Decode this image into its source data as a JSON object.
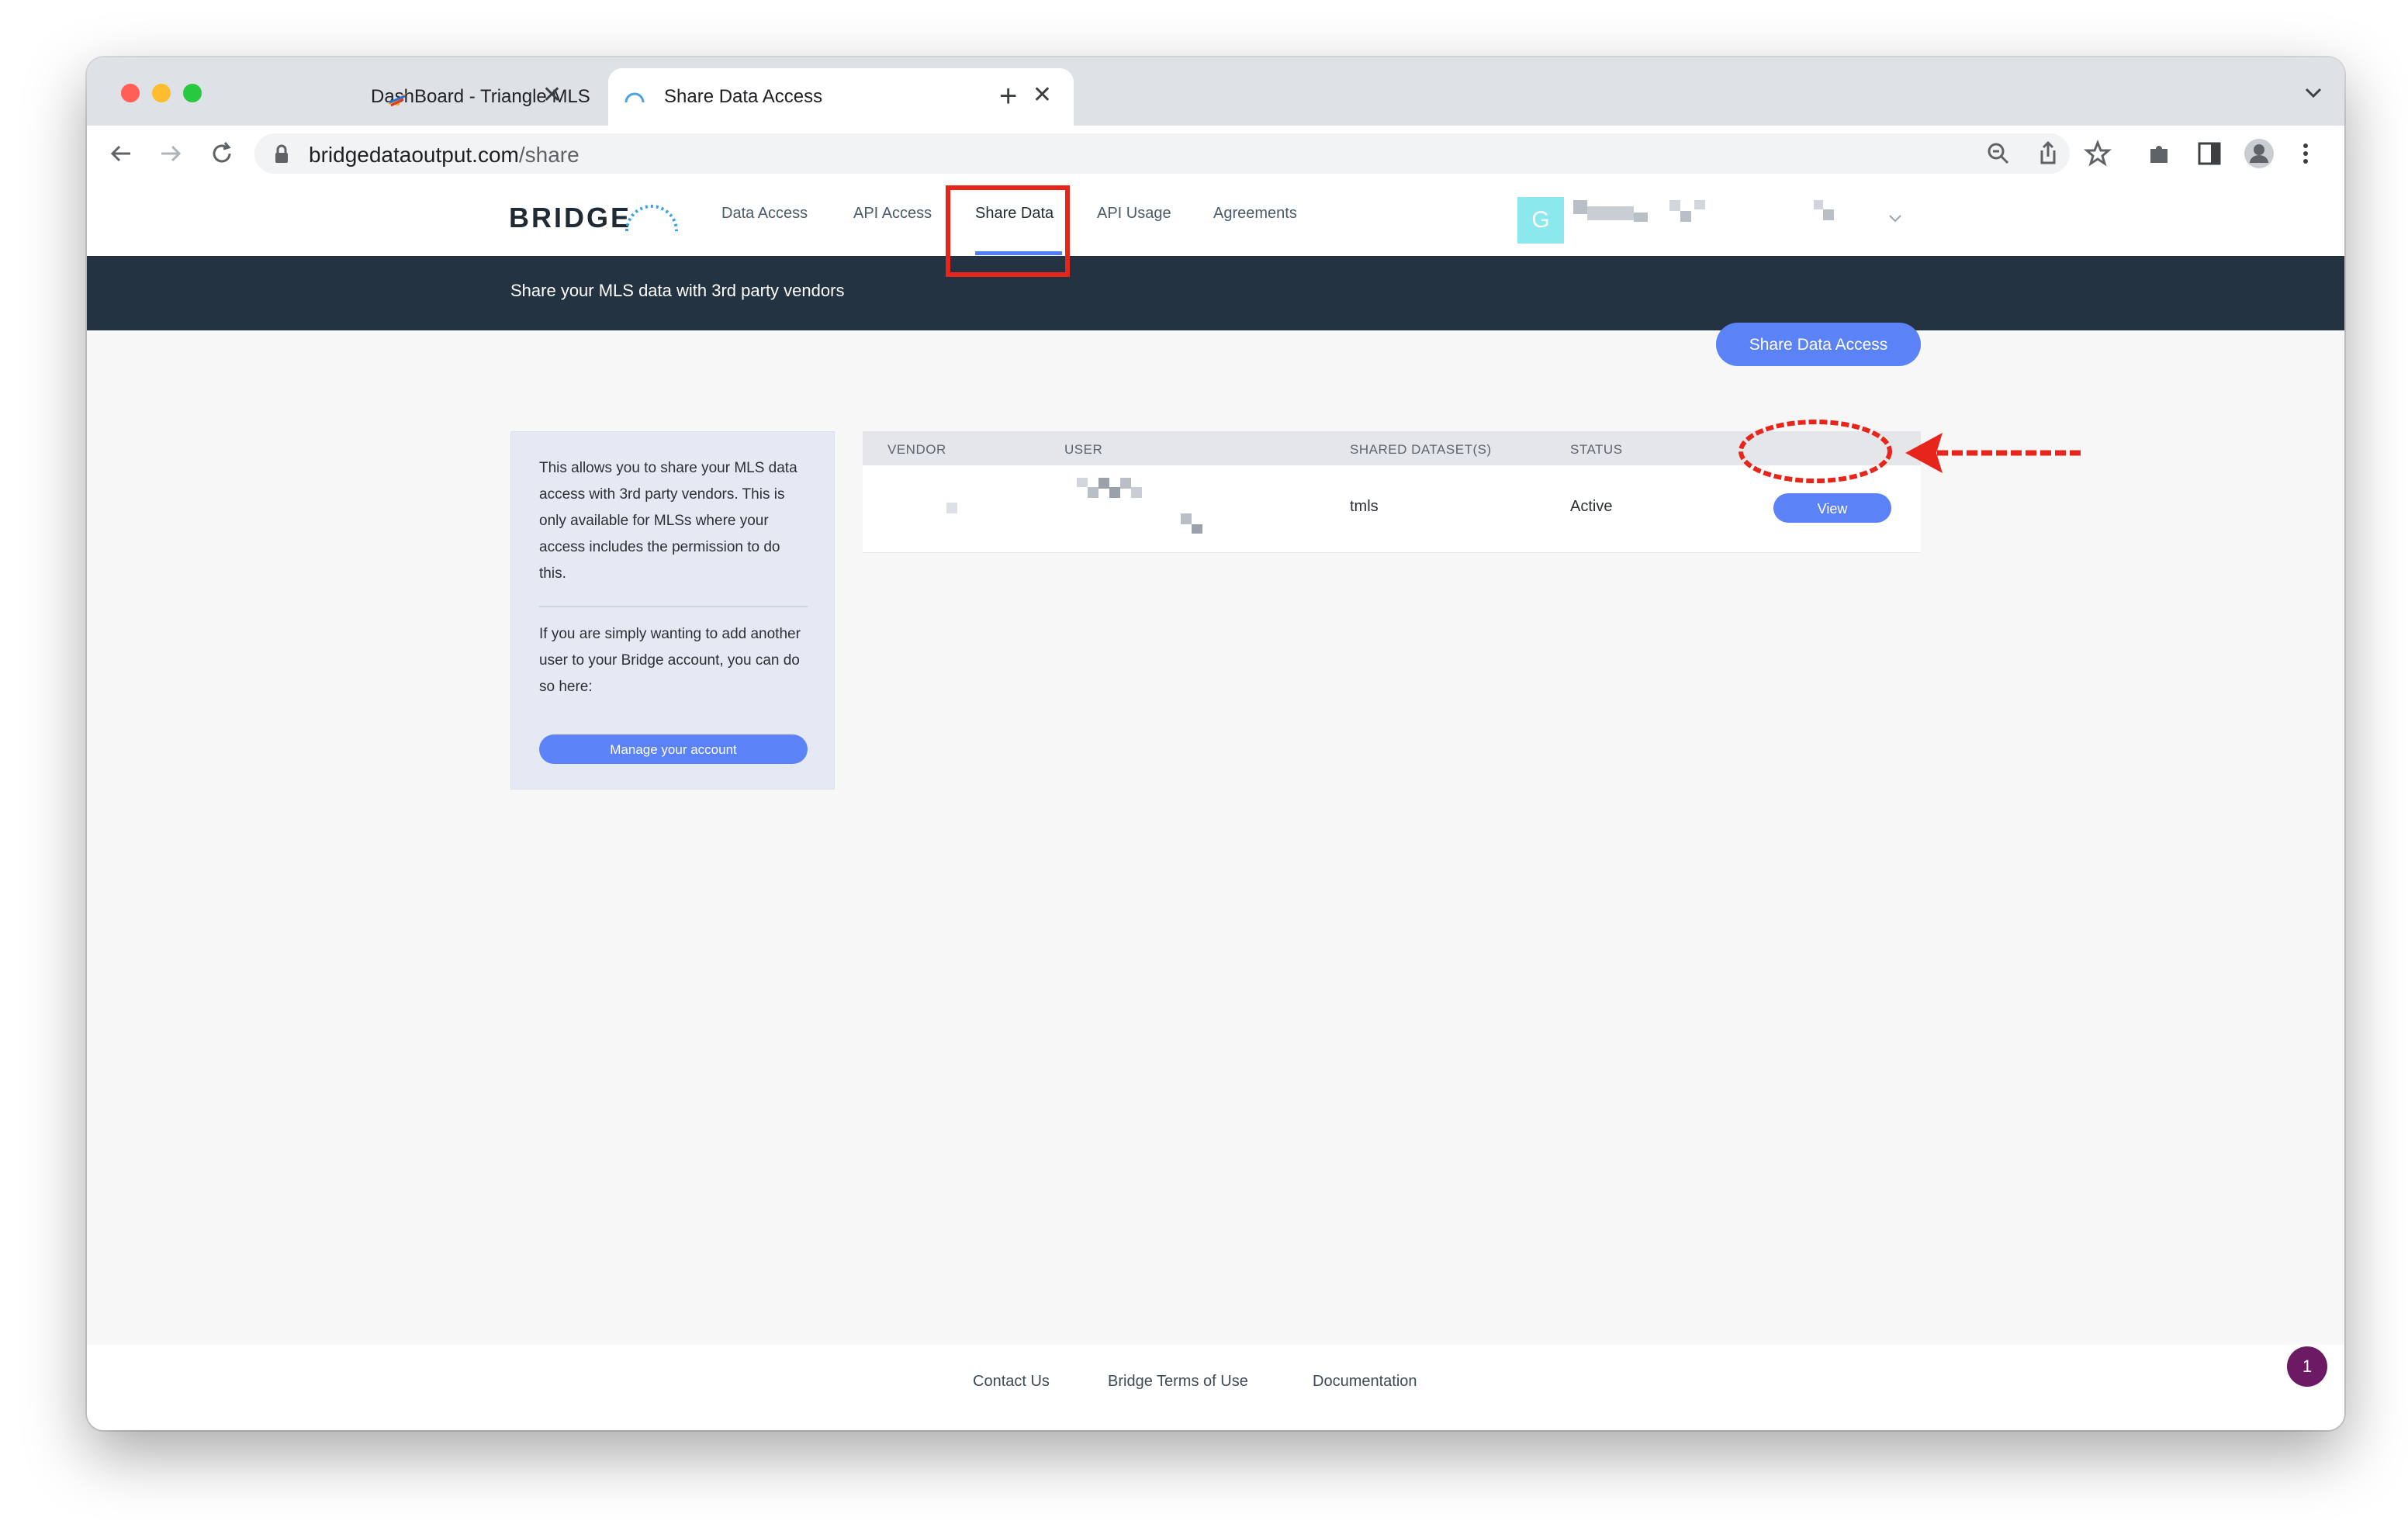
{
  "browser": {
    "tabs": [
      {
        "title": "DashBoard - Triangle MLS",
        "active": false
      },
      {
        "title": "Share Data Access",
        "active": true
      }
    ],
    "url_host": "bridgedataoutput.com",
    "url_path": "/share",
    "tab_close_glyph": "✕",
    "new_tab_glyph": "+"
  },
  "site": {
    "logo": "BRIDGE",
    "nav": [
      "Data Access",
      "API Access",
      "Share Data",
      "API Usage",
      "Agreements"
    ],
    "active_nav": "Share Data",
    "avatar_initial": "G",
    "banner_text": "Share your MLS data with 3rd party vendors",
    "share_button": "Share Data Access"
  },
  "info_card": {
    "paragraph1": "This allows you to share your MLS data access with 3rd party vendors. This is only available for MLSs where your access includes the permission to do this.",
    "paragraph2": "If you are simply wanting to add another user to your Bridge account, you can do so here:",
    "button": "Manage your account"
  },
  "table": {
    "headers": [
      "VENDOR",
      "USER",
      "SHARED DATASET(S)",
      "STATUS"
    ],
    "rows": [
      {
        "vendor": "",
        "user": "",
        "datasets": "tmls",
        "status": "Active",
        "action": "View"
      }
    ]
  },
  "footer": {
    "links": [
      "Contact Us",
      "Bridge Terms of Use",
      "Documentation"
    ],
    "notification_count": "1"
  },
  "colors": {
    "accent": "#5b82f6",
    "banner": "#243341",
    "annotation": "#e8251a",
    "avatar": "#8be9ee",
    "notification": "#6b1a63"
  }
}
